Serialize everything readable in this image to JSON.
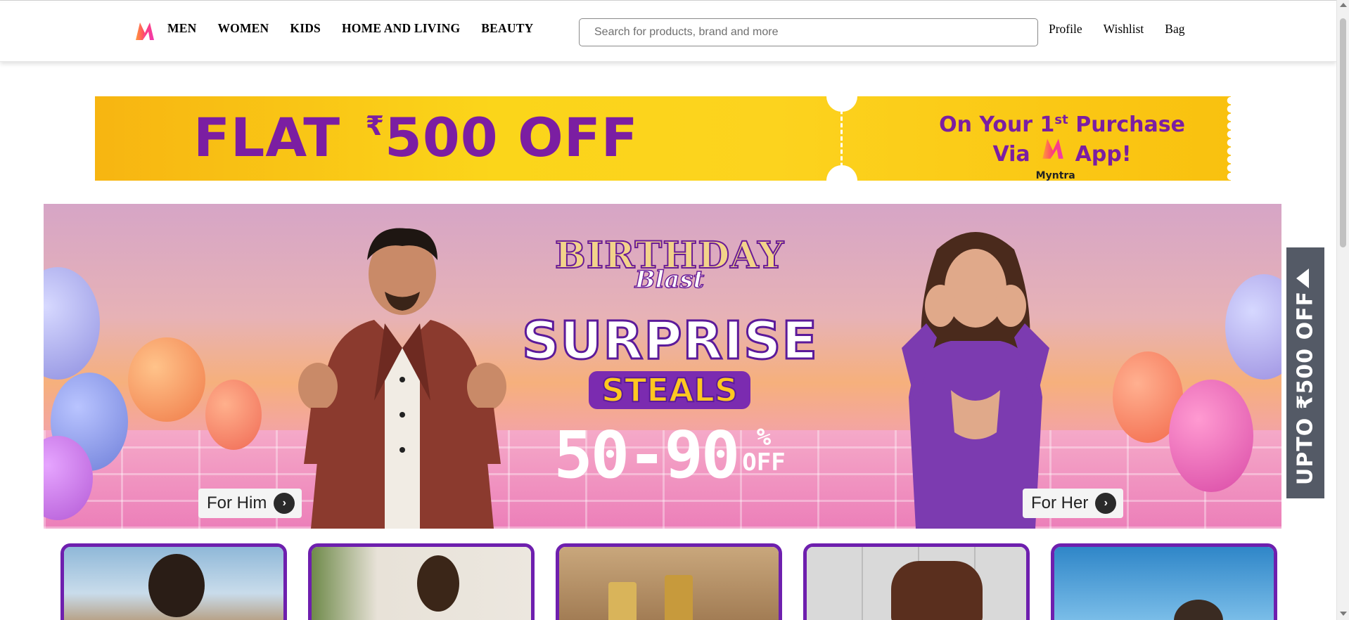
{
  "header": {
    "logo_icon": "myntra-logo-icon",
    "nav": [
      "MEN",
      "WOMEN",
      "KIDS",
      "HOME AND LIVING",
      "BEAUTY"
    ],
    "search": {
      "placeholder": "Search for products, brand and more",
      "value": ""
    },
    "actions": {
      "profile": "Profile",
      "wishlist": "Wishlist",
      "bag": "Bag"
    }
  },
  "promo": {
    "headline_prefix": "FLAT",
    "currency": "₹",
    "headline_amount": "500 OFF",
    "line1_prefix": "On Your 1",
    "line1_sup": "st",
    "line1_suffix": "Purchase",
    "line2_prefix": "Via",
    "line2_brand": "Myntra",
    "line2_suffix": "App!",
    "colors": {
      "background": "#fbd51a",
      "text": "#7b1ea2"
    }
  },
  "hero": {
    "logo_text": "M",
    "title_line1": "BIRTHDAY",
    "title_line2": "Blast",
    "headline1": "SURPRISE",
    "headline2": "STEALS",
    "discount": "50-90",
    "percent": "%",
    "off": "OFF",
    "for_him": "For Him",
    "for_her": "For Her"
  },
  "side_tab": {
    "label": "UPTO ₹500 OFF",
    "color": "#545a66"
  },
  "categories": [
    {
      "name": "category-card-1"
    },
    {
      "name": "category-card-2"
    },
    {
      "name": "category-card-3"
    },
    {
      "name": "category-card-4"
    },
    {
      "name": "category-card-5"
    }
  ],
  "accent": "#6e1fae"
}
